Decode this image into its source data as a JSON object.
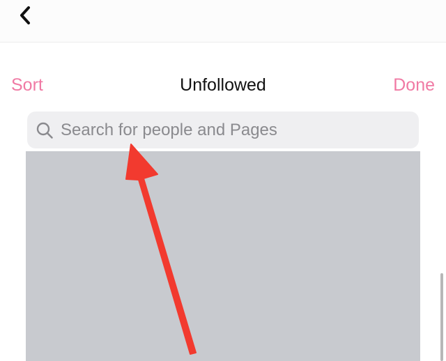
{
  "nav": {
    "back_icon": "chevron-left-icon"
  },
  "header": {
    "sort_label": "Sort",
    "title": "Unfollowed",
    "done_label": "Done"
  },
  "search": {
    "placeholder": "Search for people and Pages",
    "value": "",
    "icon": "search-icon"
  },
  "colors": {
    "accent": "#f07aa4",
    "annotation_arrow": "#f23a2f",
    "results_background": "#c8cacf",
    "search_background": "#efeff1"
  }
}
